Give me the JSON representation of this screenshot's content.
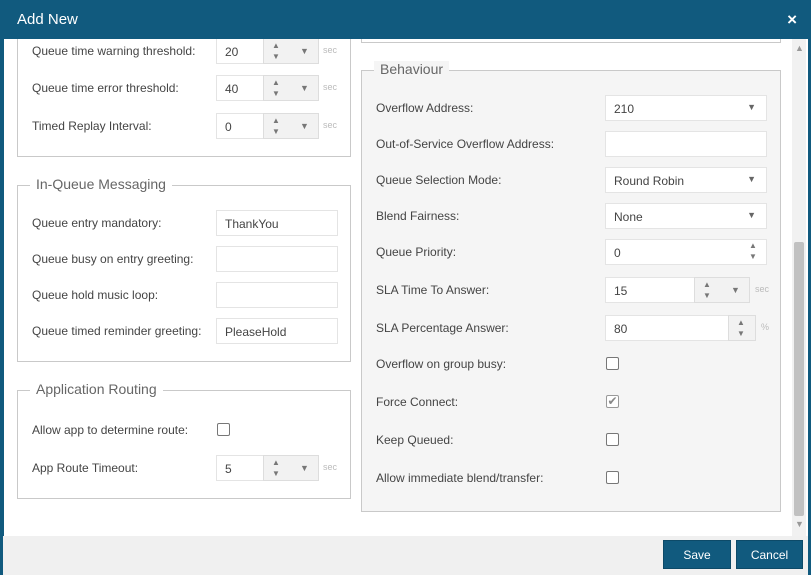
{
  "dialog": {
    "title": "Add New",
    "close_icon": "×"
  },
  "thresholds": {
    "rows": [
      {
        "label": "Queue time warning threshold:",
        "value": "20",
        "unit": "sec"
      },
      {
        "label": "Queue time error threshold:",
        "value": "40",
        "unit": "sec"
      },
      {
        "label": "Timed Replay Interval:",
        "value": "0",
        "unit": "sec"
      }
    ]
  },
  "in_queue": {
    "legend": "In-Queue Messaging",
    "rows": [
      {
        "label": "Queue entry mandatory:",
        "value": "ThankYou"
      },
      {
        "label": "Queue busy on entry greeting:",
        "value": ""
      },
      {
        "label": "Queue hold music loop:",
        "value": ""
      },
      {
        "label": "Queue timed reminder greeting:",
        "value": "PleaseHold"
      }
    ]
  },
  "app_routing": {
    "legend": "Application Routing",
    "allow_label": "Allow app to determine route:",
    "allow_checked": false,
    "timeout_label": "App Route Timeout:",
    "timeout_value": "5",
    "timeout_unit": "sec"
  },
  "behaviour": {
    "legend": "Behaviour",
    "overflow_address_label": "Overflow Address:",
    "overflow_address_value": "210",
    "oos_overflow_label": "Out-of-Service Overflow Address:",
    "oos_overflow_value": "",
    "queue_selection_label": "Queue Selection Mode:",
    "queue_selection_value": "Round Robin",
    "blend_fairness_label": "Blend Fairness:",
    "blend_fairness_value": "None",
    "queue_priority_label": "Queue Priority:",
    "queue_priority_value": "0",
    "sla_time_label": "SLA Time To Answer:",
    "sla_time_value": "15",
    "sla_time_unit": "sec",
    "sla_pct_label": "SLA Percentage Answer:",
    "sla_pct_value": "80",
    "sla_pct_unit": "%",
    "overflow_busy_label": "Overflow on group busy:",
    "force_connect_label": "Force Connect:",
    "keep_queued_label": "Keep Queued:",
    "allow_blend_label": "Allow immediate blend/transfer:",
    "checkboxes": {
      "overflow_busy": false,
      "force_connect": true,
      "keep_queued": false,
      "allow_blend": false
    }
  },
  "footer": {
    "save_label": "Save",
    "cancel_label": "Cancel"
  },
  "colors": {
    "header": "#115a7e",
    "button": "#115a7e"
  }
}
